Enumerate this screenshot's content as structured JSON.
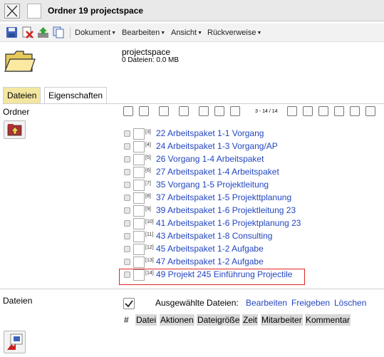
{
  "window": {
    "title": "Ordner 19 projectspace"
  },
  "toolbar": {
    "icons": [
      "save-icon",
      "delete-icon",
      "upload-icon",
      "copy-icon"
    ],
    "menus": [
      {
        "label": "Dokument"
      },
      {
        "label": "Bearbeiten"
      },
      {
        "label": "Ansicht"
      },
      {
        "label": "Rückverweise"
      }
    ]
  },
  "space": {
    "name": "projectspace",
    "info": "0 Dateien: 0.0 MB"
  },
  "tabs": [
    {
      "label": "Dateien",
      "active": true
    },
    {
      "label": "Eigenschaften",
      "active": false
    }
  ],
  "folder_section": {
    "label": "Ordner"
  },
  "pager": {
    "text": "3 - 14 / 14"
  },
  "items": [
    {
      "num": "[3]",
      "label": "22 Arbeitspaket 1-1 Vorgang"
    },
    {
      "num": "[4]",
      "label": "24 Arbeitspaket 1-3 Vorgang/AP"
    },
    {
      "num": "[5]",
      "label": "26 Vorgang 1-4 Arbeitspaket"
    },
    {
      "num": "[6]",
      "label": "27 Arbeitspaket 1-4 Arbeitspaket"
    },
    {
      "num": "[7]",
      "label": "35 Vorgang 1-5 Projektleitung"
    },
    {
      "num": "[8]",
      "label": "37 Arbeitspaket 1-5 Projekttplanung"
    },
    {
      "num": "[9]",
      "label": "39 Arbeitspaket 1-6 Projektleitung 23"
    },
    {
      "num": "[10]",
      "label": "41 Arbeitspaket 1-6 Projektplanung 23"
    },
    {
      "num": "[11]",
      "label": "43 Arbeitspaket 1-8 Consulting"
    },
    {
      "num": "[12]",
      "label": "45 Arbeitspaket 1-2 Aufgabe"
    },
    {
      "num": "[13]",
      "label": "47 Arbeitspaket 1-2 Aufgabe"
    },
    {
      "num": "[14]",
      "label": "49 Projekt 245 Einführung Projectile"
    }
  ],
  "files_section": {
    "label": "Dateien",
    "selected_label": "Ausgewählte Dateien:",
    "actions": [
      "Bearbeiten",
      "Freigeben",
      "Löschen"
    ],
    "columns": [
      "#",
      "Datei",
      "Aktionen",
      "Dateigröße",
      "Zeit",
      "Mitarbeiter",
      "Kommentar"
    ]
  },
  "colors": {
    "link": "#2346c0",
    "active_tab": "#f2e6a0",
    "highlight_border": "#e22525",
    "header_bg": "#d8d8d8"
  }
}
